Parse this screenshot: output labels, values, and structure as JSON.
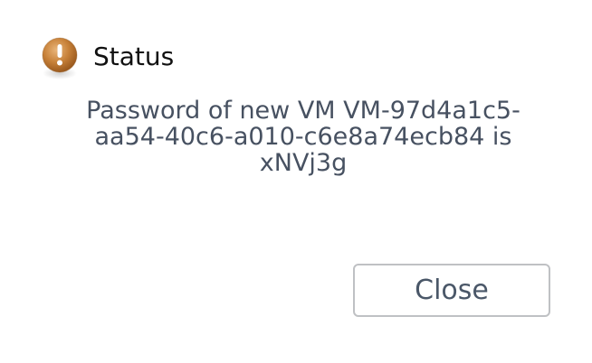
{
  "dialog": {
    "icon": "warning-icon",
    "title": "Status",
    "message": "Password of new VM VM-97d4a1c5-aa54-40c6-a010-c6e8a74ecb84 is xNVj3g",
    "close_label": "Close"
  },
  "colors": {
    "icon_orange": "#c8823a",
    "text_title": "#111111",
    "text_message": "#475161",
    "button_border": "#bfc1c4",
    "button_text": "#4a5768"
  }
}
